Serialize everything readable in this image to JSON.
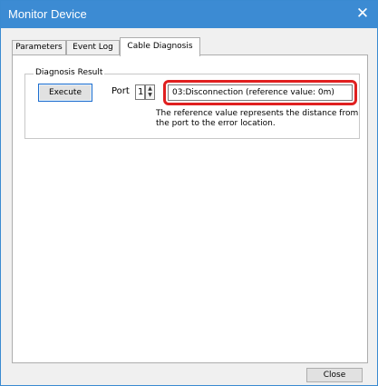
{
  "window": {
    "title": "Monitor Device",
    "close_glyph": "✕"
  },
  "tabs": [
    {
      "label": "Parameters"
    },
    {
      "label": "Event Log"
    },
    {
      "label": "Cable Diagnosis"
    }
  ],
  "diagnosis": {
    "group_label": "Diagnosis Result",
    "execute_label": "Execute",
    "port_label": "Port",
    "port_value": "1",
    "result_value": "03:Disconnection (reference value: 0m)",
    "note_line1": "The reference value represents the distance from",
    "note_line2": "the port to the error location."
  },
  "footer": {
    "close_label": "Close"
  },
  "colors": {
    "titlebar": "#3c8bd3",
    "highlight": "#e02020"
  }
}
